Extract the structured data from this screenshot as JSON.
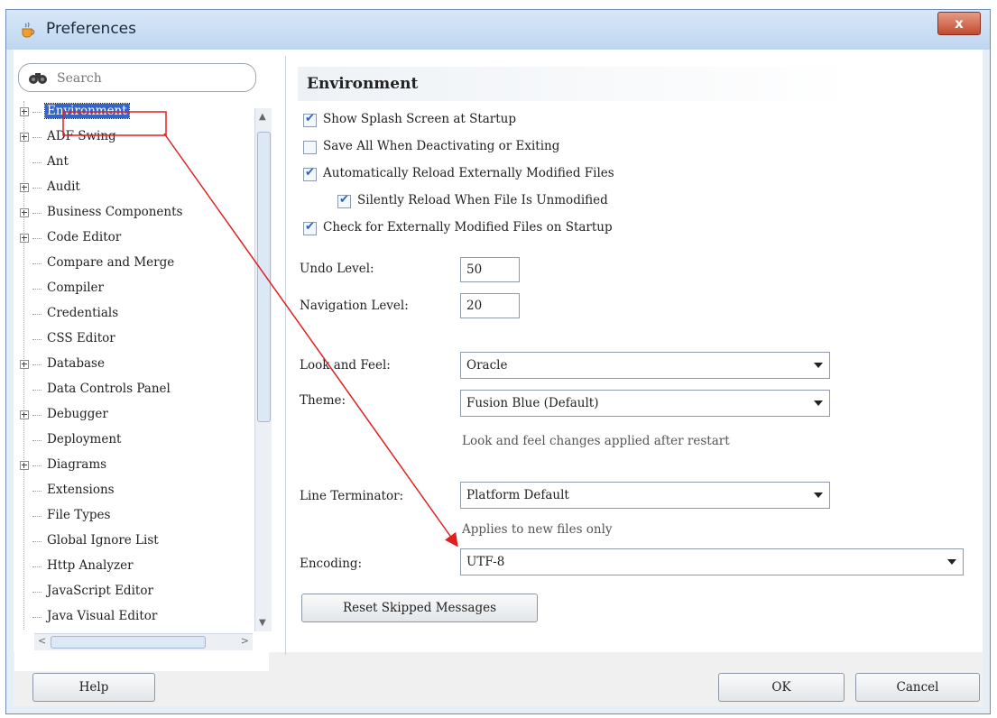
{
  "window": {
    "title": "Preferences",
    "close_glyph": "x"
  },
  "search": {
    "placeholder": "Search"
  },
  "tree": {
    "items": [
      {
        "label": "Environment",
        "expandable": true,
        "selected": true
      },
      {
        "label": "ADF Swing",
        "expandable": true
      },
      {
        "label": "Ant",
        "expandable": false
      },
      {
        "label": "Audit",
        "expandable": true
      },
      {
        "label": "Business Components",
        "expandable": true
      },
      {
        "label": "Code Editor",
        "expandable": true
      },
      {
        "label": "Compare and Merge",
        "expandable": false
      },
      {
        "label": "Compiler",
        "expandable": false
      },
      {
        "label": "Credentials",
        "expandable": false
      },
      {
        "label": "CSS Editor",
        "expandable": false
      },
      {
        "label": "Database",
        "expandable": true
      },
      {
        "label": "Data Controls Panel",
        "expandable": false
      },
      {
        "label": "Debugger",
        "expandable": true
      },
      {
        "label": "Deployment",
        "expandable": false
      },
      {
        "label": "Diagrams",
        "expandable": true
      },
      {
        "label": "Extensions",
        "expandable": false
      },
      {
        "label": "File Types",
        "expandable": false
      },
      {
        "label": "Global Ignore List",
        "expandable": false
      },
      {
        "label": "Http Analyzer",
        "expandable": false
      },
      {
        "label": "JavaScript Editor",
        "expandable": false
      },
      {
        "label": "Java Visual Editor",
        "expandable": false
      }
    ]
  },
  "environment": {
    "title": "Environment",
    "checkboxes": [
      {
        "label": "Show Splash Screen at Startup",
        "checked": true
      },
      {
        "label": "Save All When Deactivating or Exiting",
        "checked": false
      },
      {
        "label": "Automatically Reload Externally Modified Files",
        "checked": true
      },
      {
        "label": "Silently Reload When File Is Unmodified",
        "checked": true
      },
      {
        "label": "Check for Externally Modified Files on Startup",
        "checked": true
      }
    ],
    "undo_level_label": "Undo Level:",
    "undo_level_value": "50",
    "navigation_level_label": "Navigation Level:",
    "navigation_level_value": "20",
    "look_and_feel_label": "Look and Feel:",
    "look_and_feel_value": "Oracle",
    "theme_label": "Theme:",
    "theme_value": "Fusion Blue (Default)",
    "look_hint": "Look and feel changes applied after restart",
    "line_terminator_label": "Line Terminator:",
    "line_terminator_value": "Platform Default",
    "line_hint": "Applies to new files only",
    "encoding_label": "Encoding:",
    "encoding_value": "UTF-8",
    "reset_button": "Reset Skipped Messages"
  },
  "footer": {
    "help": "Help",
    "ok": "OK",
    "cancel": "Cancel"
  },
  "colors": {
    "selection": "#3366cc",
    "annotation_arrow": "#e02020",
    "checkmark": "#2a62b8"
  },
  "icons": {
    "search": "binoculars-icon",
    "window": "java-cup-icon"
  }
}
